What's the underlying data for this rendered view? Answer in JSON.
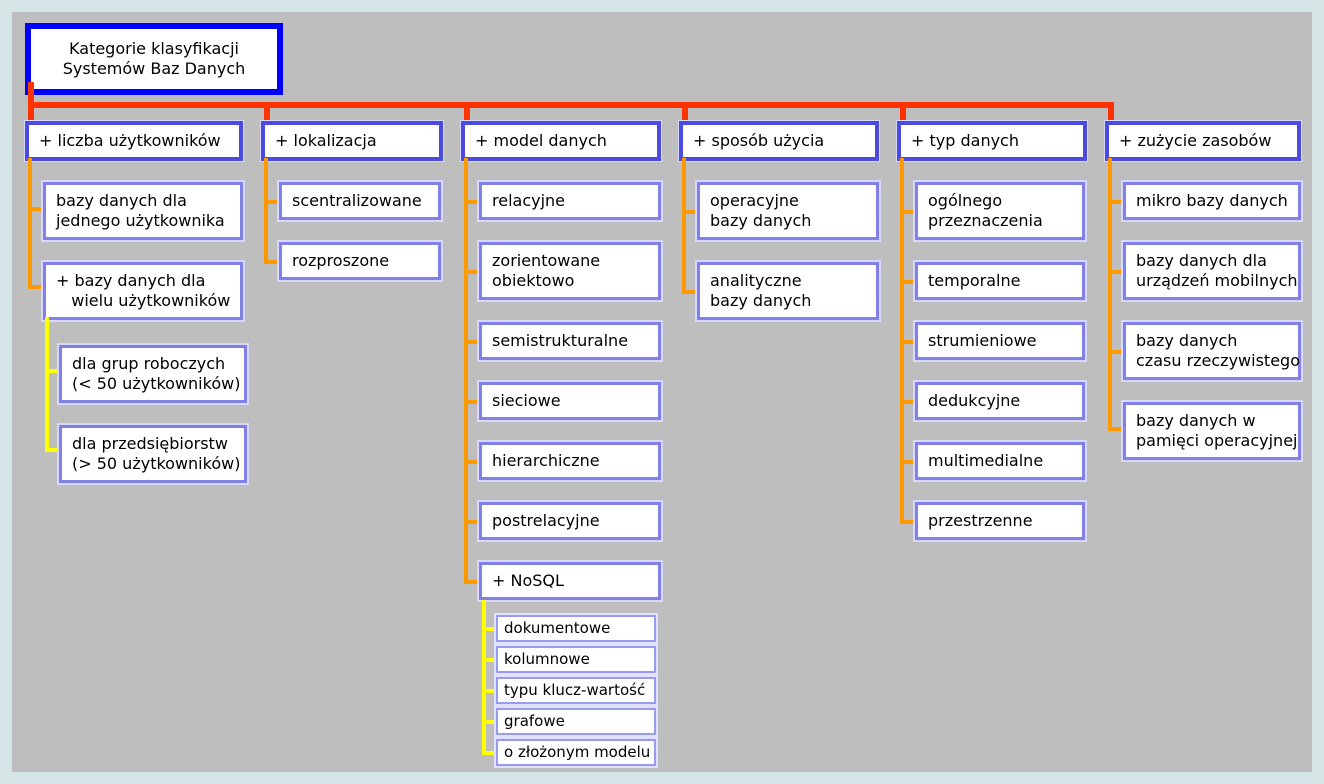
{
  "root": "Kategorie klasyfikacji\nSystemów Baz Danych",
  "categories": [
    {
      "label": "+ liczba użytkowników",
      "children": [
        {
          "label": "bazy danych dla\njednego użytkownika"
        },
        {
          "label": "+ bazy danych dla\n   wielu użytkowników",
          "children": [
            {
              "label": "dla grup roboczych\n(< 50 użytkowników)"
            },
            {
              "label": "dla przedsiębiorstw\n(> 50 użytkowników)"
            }
          ]
        }
      ]
    },
    {
      "label": "+ lokalizacja",
      "children": [
        {
          "label": "scentralizowane"
        },
        {
          "label": "rozproszone"
        }
      ]
    },
    {
      "label": "+ model danych",
      "children": [
        {
          "label": "relacyjne"
        },
        {
          "label": "zorientowane\nobiektowo"
        },
        {
          "label": "semistrukturalne"
        },
        {
          "label": "sieciowe"
        },
        {
          "label": "hierarchiczne"
        },
        {
          "label": "postrelacyjne"
        },
        {
          "label": "+ NoSQL",
          "children": [
            {
              "label": "dokumentowe"
            },
            {
              "label": "kolumnowe"
            },
            {
              "label": "typu klucz-wartość"
            },
            {
              "label": "grafowe"
            },
            {
              "label": "o złożonym modelu"
            }
          ]
        }
      ]
    },
    {
      "label": "+ sposób użycia",
      "children": [
        {
          "label": "operacyjne\nbazy danych"
        },
        {
          "label": "analityczne\nbazy danych"
        }
      ]
    },
    {
      "label": "+ typ danych",
      "children": [
        {
          "label": "ogólnego\nprzeznaczenia"
        },
        {
          "label": "temporalne"
        },
        {
          "label": "strumieniowe"
        },
        {
          "label": "dedukcyjne"
        },
        {
          "label": "multimedialne"
        },
        {
          "label": "przestrzenne"
        }
      ]
    },
    {
      "label": "+ zużycie zasobów",
      "children": [
        {
          "label": "mikro bazy danych"
        },
        {
          "label": "bazy danych dla\nurządzeń mobilnych"
        },
        {
          "label": "bazy danych\nczasu rzeczywistego"
        },
        {
          "label": "bazy danych w\npamięci operacyjnej"
        }
      ]
    }
  ]
}
